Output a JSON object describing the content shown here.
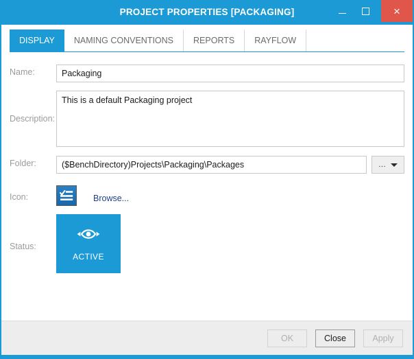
{
  "window": {
    "title": "PROJECT PROPERTIES [PACKAGING]",
    "accent_color": "#1b9ad6",
    "close_button_color": "#e0564b",
    "controls": {
      "minimize": "minimize",
      "maximize": "maximize",
      "close": "×"
    }
  },
  "tabs": [
    {
      "label": "DISPLAY",
      "active": true
    },
    {
      "label": "NAMING CONVENTIONS",
      "active": false
    },
    {
      "label": "REPORTS",
      "active": false
    },
    {
      "label": "RAYFLOW",
      "active": false
    }
  ],
  "form": {
    "name": {
      "label": "Name:",
      "value": "Packaging",
      "placeholder": ""
    },
    "description": {
      "label": "Description:",
      "value": "This is a default Packaging project",
      "placeholder": ""
    },
    "folder": {
      "label": "Folder:",
      "value": "($BenchDirectory)Projects\\Packaging\\Packages",
      "placeholder": "",
      "browse_ellipsis": "...",
      "dropdown_icon": "chevron-down-icon"
    },
    "icon": {
      "label": "Icon:",
      "tile_icon": "checklist-icon",
      "browse_link": "Browse...",
      "link_color": "#1f3f8f"
    },
    "status": {
      "label": "Status:",
      "tile_icon": "eye-icon",
      "tile_label": "ACTIVE",
      "tile_color": "#1b9ad6"
    }
  },
  "footer": {
    "buttons": [
      {
        "label": "OK",
        "enabled": false
      },
      {
        "label": "Close",
        "enabled": true
      },
      {
        "label": "Apply",
        "enabled": false
      }
    ]
  }
}
